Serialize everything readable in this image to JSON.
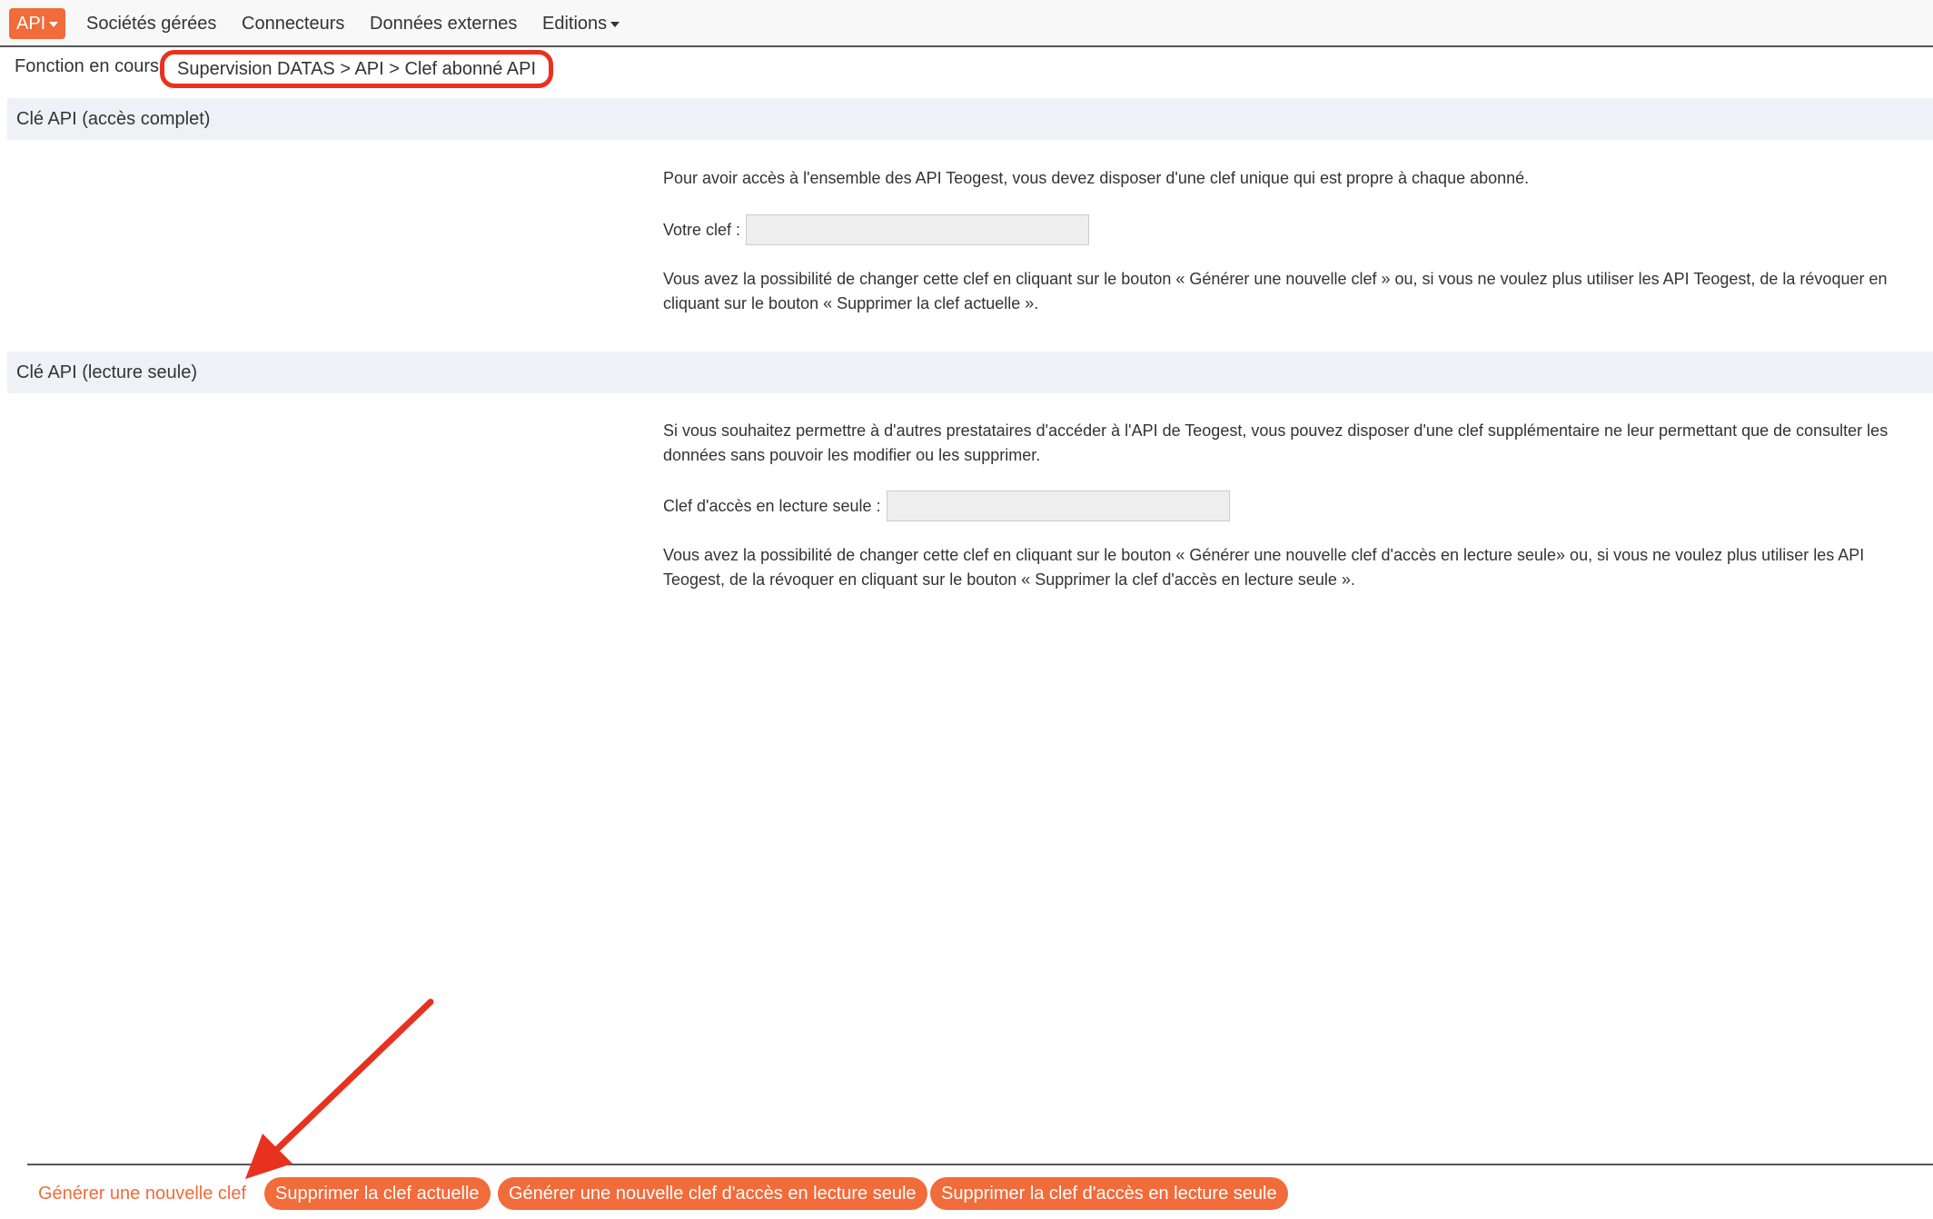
{
  "nav": {
    "items": [
      {
        "label": "API",
        "has_dropdown": true,
        "active": true
      },
      {
        "label": "Sociétés gérées",
        "has_dropdown": false
      },
      {
        "label": "Connecteurs",
        "has_dropdown": false
      },
      {
        "label": "Données externes",
        "has_dropdown": false
      },
      {
        "label": "Editions",
        "has_dropdown": true
      }
    ]
  },
  "breadcrumb": {
    "label": "Fonction en cours",
    "path": "Supervision DATAS > API > Clef abonné API"
  },
  "section_full": {
    "title": "Clé API (accès complet)",
    "intro": "Pour avoir accès à l'ensemble des API Teogest, vous devez disposer d'une clef unique qui est propre à chaque abonné.",
    "field_label": "Votre clef :",
    "field_value": "",
    "note": "Vous avez la possibilité de changer cette clef en cliquant sur le bouton « Générer une nouvelle clef » ou, si vous ne voulez plus utiliser les API Teogest, de la révoquer en cliquant sur le bouton « Supprimer la clef actuelle »."
  },
  "section_readonly": {
    "title": "Clé API (lecture seule)",
    "intro": "Si vous souhaitez permettre à d'autres prestataires d'accéder à l'API de Teogest, vous pouvez disposer d'une clef supplémentaire ne leur permettant que de consulter les données sans pouvoir les modifier ou les supprimer.",
    "field_label": "Clef d'accès en lecture seule :",
    "field_value": "",
    "note": "Vous avez la possibilité de changer cette clef en cliquant sur le bouton « Générer une nouvelle clef d'accès en lecture seule» ou, si vous ne voulez plus utiliser les API Teogest, de la révoquer en cliquant sur le bouton « Supprimer la clef d'accès en lecture seule »."
  },
  "footer": {
    "generate_key": "Générer une nouvelle clef",
    "delete_key": "Supprimer la clef actuelle",
    "generate_readonly_key": "Générer une nouvelle clef d'accès en lecture seule",
    "delete_readonly_key": "Supprimer la clef d'accès en lecture seule"
  },
  "colors": {
    "accent": "#f26b3a",
    "annotation": "#e8321f",
    "section_header_bg": "#eef1f6",
    "field_bg": "#eeeeee"
  },
  "icons": {
    "dropdown": "caret-down-icon",
    "annotation": "arrow-annotation"
  }
}
